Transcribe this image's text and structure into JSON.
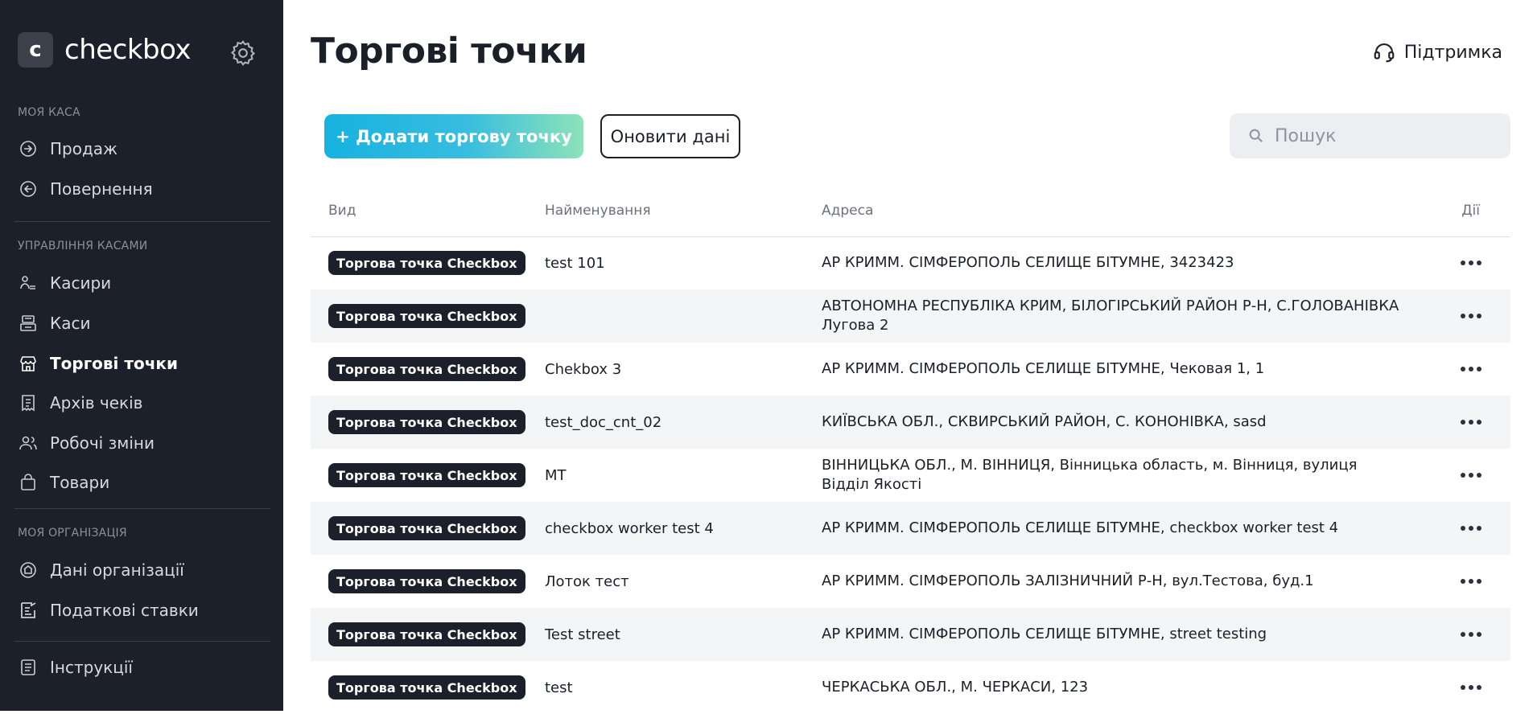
{
  "sidebar": {
    "logo_letter": "c",
    "logo_text": "checkbox",
    "sections": [
      {
        "label": "МОЯ КАСА"
      },
      {
        "label": "УПРАВЛІННЯ КАСАМИ"
      },
      {
        "label": "МОЯ ОРГАНІЗАЦІЯ"
      }
    ],
    "items": [
      {
        "label": "Продаж",
        "icon": "sale-icon"
      },
      {
        "label": "Повернення",
        "icon": "return-icon"
      },
      {
        "label": "Касири",
        "icon": "cashiers-icon"
      },
      {
        "label": "Каси",
        "icon": "registers-icon"
      },
      {
        "label": "Торгові точки",
        "icon": "store-icon",
        "active": true
      },
      {
        "label": "Архів чеків",
        "icon": "receipts-archive-icon"
      },
      {
        "label": "Робочі зміни",
        "icon": "shifts-icon"
      },
      {
        "label": "Товари",
        "icon": "bag-icon"
      },
      {
        "label": "Дані організації",
        "icon": "organization-icon"
      },
      {
        "label": "Податкові ставки",
        "icon": "tax-rates-icon"
      },
      {
        "label": "Інструкції",
        "icon": "instructions-icon"
      }
    ]
  },
  "header": {
    "title": "Торгові точки",
    "support_label": "Підтримка"
  },
  "toolbar": {
    "add_label": "+ Додати торгову точку",
    "refresh_label": "Оновити дані",
    "search_placeholder": "Пошук"
  },
  "table": {
    "columns": [
      "Вид",
      "Найменування",
      "Адреса",
      "Дії"
    ],
    "rows": [
      {
        "type": "Торгова точка Checkbox",
        "name": "test 101",
        "address": "АР КРИММ. СІМФЕРОПОЛЬ СЕЛИЩЕ БІТУМНЕ, 3423423"
      },
      {
        "type": "Торгова точка Checkbox",
        "name": "",
        "address": "АВТОНОМНА РЕСПУБЛІКА КРИМ, БІЛОГІРСЬКИЙ РАЙОН Р-Н, С.ГОЛОВАНІВКА Лугова 2"
      },
      {
        "type": "Торгова точка Checkbox",
        "name": "Chekbox 3",
        "address": "АР КРИММ. СІМФЕРОПОЛЬ СЕЛИЩЕ БІТУМНЕ, Чековая 1, 1"
      },
      {
        "type": "Торгова точка Checkbox",
        "name": "test_doc_cnt_02",
        "address": "КИЇВСЬКА ОБЛ., СКВИРСЬКИЙ РАЙОН, С. КОНОНІВКА, sasd"
      },
      {
        "type": "Торгова точка Checkbox",
        "name": "МТ",
        "address": "ВІННИЦЬКА ОБЛ., М. ВІННИЦЯ, Вінницька область, м. Вінниця, вулиця Відділ Якості"
      },
      {
        "type": "Торгова точка Checkbox",
        "name": "checkbox worker test 4",
        "address": "АР КРИММ. СІМФЕРОПОЛЬ СЕЛИЩЕ БІТУМНЕ, checkbox worker test 4"
      },
      {
        "type": "Торгова точка Checkbox",
        "name": "Лоток тест",
        "address": "АР КРИММ. СІМФЕРОПОЛЬ ЗАЛІЗНИЧНИЙ Р-Н, вул.Тестова, буд.1"
      },
      {
        "type": "Торгова точка Checkbox",
        "name": "Test street",
        "address": "АР КРИММ. СІМФЕРОПОЛЬ СЕЛИЩЕ БІТУМНЕ, street testing"
      },
      {
        "type": "Торгова точка Checkbox",
        "name": "test",
        "address": "ЧЕРКАСЬКА ОБЛ., М. ЧЕРКАСИ, 123"
      }
    ]
  },
  "colors": {
    "sidebar_bg": "#1c202a",
    "accent_gradient_start": "#16b2e0",
    "accent_gradient_end": "#8ee3b8",
    "badge_bg": "#1c202a"
  }
}
